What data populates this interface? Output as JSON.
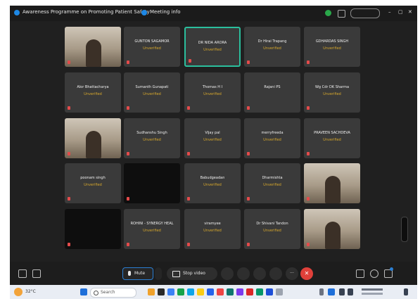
{
  "window": {
    "title": "Awareness Programme on Promoting Patient Safety",
    "meeting_info": "Meeting info",
    "window_controls": [
      "–",
      "▢",
      "✕"
    ]
  },
  "participants": [
    {
      "name": "",
      "status": "",
      "kind": "video"
    },
    {
      "name": "GUNTON SAGAMOR",
      "status": "Unverified",
      "kind": "tile"
    },
    {
      "name": "DR NIDA ARORA",
      "status": "Unverified",
      "kind": "tile",
      "active": true
    },
    {
      "name": "Dr Hirai Trapang",
      "status": "Unverified",
      "kind": "tile"
    },
    {
      "name": "GDHARDAS SINGH",
      "status": "Unverified",
      "kind": "tile"
    },
    {
      "name": "Alor Bhattacharya",
      "status": "Unverified",
      "kind": "tile"
    },
    {
      "name": "Sumanth Gunapati",
      "status": "Unverified",
      "kind": "tile"
    },
    {
      "name": "Thomas H I",
      "status": "Unverified",
      "kind": "tile"
    },
    {
      "name": "Rajani PS",
      "status": "",
      "kind": "tile"
    },
    {
      "name": "Wg Cdr DK Sharma",
      "status": "Unverified",
      "kind": "tile"
    },
    {
      "name": "",
      "status": "",
      "kind": "video"
    },
    {
      "name": "Sudhanshu Singh",
      "status": "Unverified",
      "kind": "tile"
    },
    {
      "name": "Vijay pal",
      "status": "Unverified",
      "kind": "tile"
    },
    {
      "name": "merryfreeda",
      "status": "Unverified",
      "kind": "tile"
    },
    {
      "name": "PRAVEEN SACHDEVA",
      "status": "Unverified",
      "kind": "tile"
    },
    {
      "name": "poonam singh",
      "status": "Unverified",
      "kind": "tile"
    },
    {
      "name": "",
      "status": "",
      "kind": "black"
    },
    {
      "name": "Babudgeadan",
      "status": "Unverified",
      "kind": "tile"
    },
    {
      "name": "Dharmishta",
      "status": "Unverified",
      "kind": "tile"
    },
    {
      "name": "",
      "status": "",
      "kind": "video"
    },
    {
      "name": "",
      "status": "",
      "kind": "black"
    },
    {
      "name": "ROHINI - SYNERGY HEAL",
      "status": "Unverified",
      "kind": "tile"
    },
    {
      "name": "viramyee",
      "status": "Unverified",
      "kind": "tile"
    },
    {
      "name": "Dr Shivani Tandon",
      "status": "Unverified",
      "kind": "tile"
    },
    {
      "name": "",
      "status": "",
      "kind": "video"
    }
  ],
  "toolbar": {
    "mute_label": "Mute",
    "stop_video_label": "Stop video",
    "more_label": "···",
    "leave_label": "✕"
  },
  "taskbar": {
    "weather": "32°C",
    "search_label": "Search"
  },
  "colors": {
    "accent": "#2bbf9d",
    "unverified": "#d6a72c",
    "leave": "#e0403a",
    "muted_mic": "#e34b4b"
  }
}
